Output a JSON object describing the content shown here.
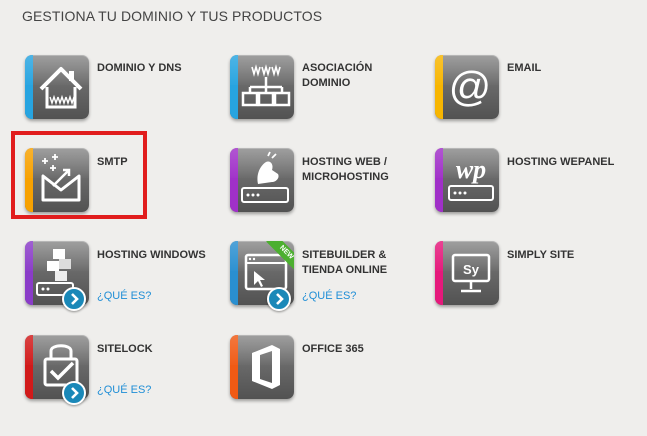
{
  "header": {
    "title": "GESTIONA TU DOMINIO Y TUS PRODUCTOS"
  },
  "products": {
    "dominio": {
      "label": "DOMINIO Y DNS",
      "color": "#27a4e0",
      "icon": "house-www-icon"
    },
    "asociacion": {
      "label_line1": "ASOCIACIÓN",
      "label_line2": "DOMINIO",
      "color": "#27a4e0",
      "icon": "domain-tree-icon"
    },
    "email": {
      "label": "EMAIL",
      "color": "#f7b500",
      "icon": "at-sign-icon"
    },
    "smtp": {
      "label": "SMTP",
      "color": "#f7a100",
      "icon": "envelope-sparkle-icon"
    },
    "hosting_web": {
      "label_line1": "HOSTING WEB /",
      "label_line2": "MICROHOSTING",
      "color": "#a030c8",
      "icon": "server-hand-icon"
    },
    "wepanel": {
      "label": "HOSTING WEPANEL",
      "color": "#a030c8",
      "icon": "wp-server-icon"
    },
    "windows": {
      "label": "HOSTING WINDOWS",
      "color": "#8a3cc8",
      "icon": "server-blocks-icon",
      "link": "¿QUÉ ES?"
    },
    "sitebuilder": {
      "label_line1": "SITEBUILDER &",
      "label_line2": "TIENDA ONLINE",
      "color": "#2a8fd0",
      "icon": "browser-cursor-icon",
      "link": "¿QUÉ ES?",
      "new_tag": "NEW"
    },
    "simply": {
      "label": "SIMPLY SITE",
      "color": "#e5197b",
      "icon": "monitor-sy-icon",
      "icon_text": "Sy"
    },
    "sitelock": {
      "label": "SITELOCK",
      "color": "#d11a1a",
      "icon": "lock-check-icon",
      "link": "¿QUÉ ES?"
    },
    "office": {
      "label": "OFFICE 365",
      "color": "#f05a14",
      "icon": "office-logo-icon"
    }
  }
}
